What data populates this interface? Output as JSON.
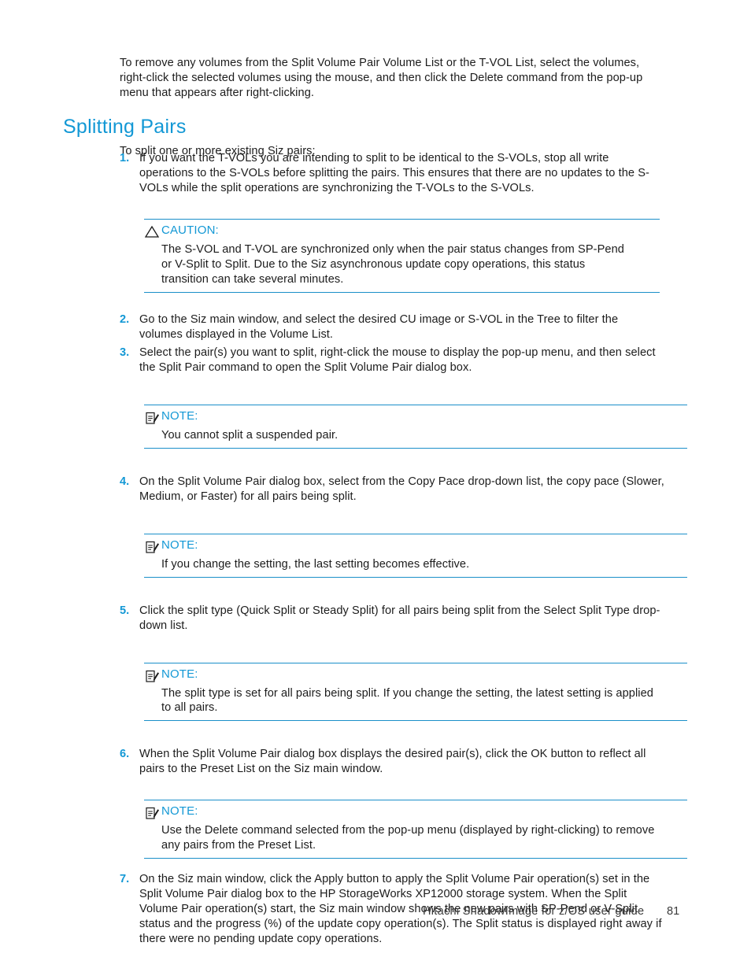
{
  "page": {
    "intro_paragraph": "To remove any volumes from the Split Volume Pair Volume List or the T-VOL List, select the volumes, right-click the selected volumes using the mouse, and then click the Delete command from the pop-up menu that appears after right-clicking.",
    "heading": "Splitting Pairs",
    "lead_in": "To split one or more existing Siz pairs:"
  },
  "accent_color": "#1398d5",
  "rule_color": "#1a8fc9",
  "steps": [
    {
      "number": "1.",
      "text": "If you want the T-VOLs you are intending to split to be identical to the S-VOLs, stop all write operations to the S-VOLs before splitting the pairs. This ensures that there are no updates to the S-VOLs while the split operations are synchronizing the T-VOLs to the S-VOLs."
    },
    {
      "number": "2.",
      "text": "Go to the Siz main window, and select the desired CU image or S-VOL in the Tree to filter the volumes displayed in the Volume List."
    },
    {
      "number": "3.",
      "text": "Select the pair(s) you want to split, right-click the mouse to display the pop-up menu, and then select the Split Pair command to open the Split Volume Pair dialog box."
    },
    {
      "number": "4.",
      "text": "On the Split Volume Pair dialog box, select from the Copy Pace drop-down list, the copy pace (Slower, Medium, or Faster) for all pairs being split."
    },
    {
      "number": "5.",
      "text": "Click the split type (Quick Split or Steady Split) for all pairs being split from the Select Split Type drop-down list."
    },
    {
      "number": "6.",
      "text": "When the Split Volume Pair dialog box displays the desired pair(s), click the OK button to reflect all pairs to the Preset List on the Siz main window."
    },
    {
      "number": "7.",
      "text": "On the Siz main window, click the Apply button to apply the Split Volume Pair operation(s) set in the Split Volume Pair dialog box to the HP StorageWorks XP12000 storage system. When the Split Volume Pair operation(s) start, the Siz main window shows the new pairs with SP-Pend or V-Split status and the progress (%) of the update copy operation(s). The Split status is displayed right away if there were no pending update copy operations."
    }
  ],
  "admonitions": [
    {
      "kind": "caution",
      "icon": "warning-triangle-icon",
      "label": "CAUTION:",
      "text": "The S-VOL and T-VOL are synchronized only when the pair status changes from SP-Pend or V-Split to Split. Due to the Siz asynchronous update copy operations, this status transition can take several minutes."
    },
    {
      "kind": "note",
      "icon": "note-clipboard-icon",
      "label": "NOTE:",
      "text": "You cannot split a suspended pair."
    },
    {
      "kind": "note",
      "icon": "note-clipboard-icon",
      "label": "NOTE:",
      "text": "If you change the setting, the last setting becomes effective."
    },
    {
      "kind": "note",
      "icon": "note-clipboard-icon",
      "label": "NOTE:",
      "text": "The split type is set for all pairs being split. If you change the setting, the latest setting is applied to all pairs."
    },
    {
      "kind": "note",
      "icon": "note-clipboard-icon",
      "label": "NOTE:",
      "text": "Use the Delete command selected from the pop-up menu (displayed by right-clicking) to remove any pairs from the Preset List."
    }
  ],
  "footer": {
    "title": "Hitachi ShadowImage for z/OS user guide",
    "page_number": "81"
  }
}
